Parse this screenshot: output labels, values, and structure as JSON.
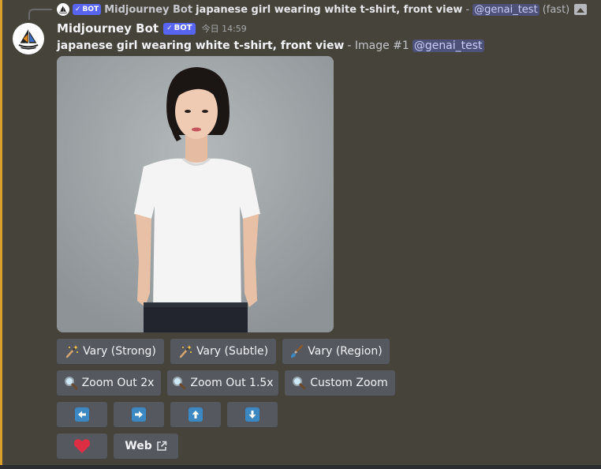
{
  "reply": {
    "author": "Midjourney Bot",
    "bot_tag": "BOT",
    "prompt": "japanese girl wearing white t-shirt, front view",
    "separator": "-",
    "mention": "@genai_test",
    "speed": "(fast)"
  },
  "message": {
    "author": "Midjourney Bot",
    "bot_tag": "BOT",
    "timestamp": "今日 14:59",
    "prompt": "japanese girl wearing white t-shirt, front view",
    "suffix": "- Image #1",
    "mention": "@genai_test"
  },
  "image": {
    "alt_subject": "portrait-photo"
  },
  "buttons": {
    "vary_strong": "Vary (Strong)",
    "vary_subtle": "Vary (Subtle)",
    "vary_region": "Vary (Region)",
    "zoom_out_2x": "Zoom Out 2x",
    "zoom_out_1_5x": "Zoom Out 1.5x",
    "custom_zoom": "Custom Zoom",
    "web": "Web"
  },
  "icons": {
    "vary": "magic-wand-icon",
    "region": "paintbrush-icon",
    "zoom": "magnifier-icon",
    "pan_left": "arrow-left-icon",
    "pan_right": "arrow-right-icon",
    "pan_up": "arrow-up-icon",
    "pan_down": "arrow-down-icon",
    "favorite": "heart-icon",
    "external": "external-link-icon"
  },
  "colors": {
    "background": "#46433b",
    "accent": "#d9a12b",
    "button": "#55585f",
    "bot_tag": "#5865f2",
    "mention": "#4f5278",
    "arrow": "#3b88c3",
    "heart": "#dd2e44"
  }
}
